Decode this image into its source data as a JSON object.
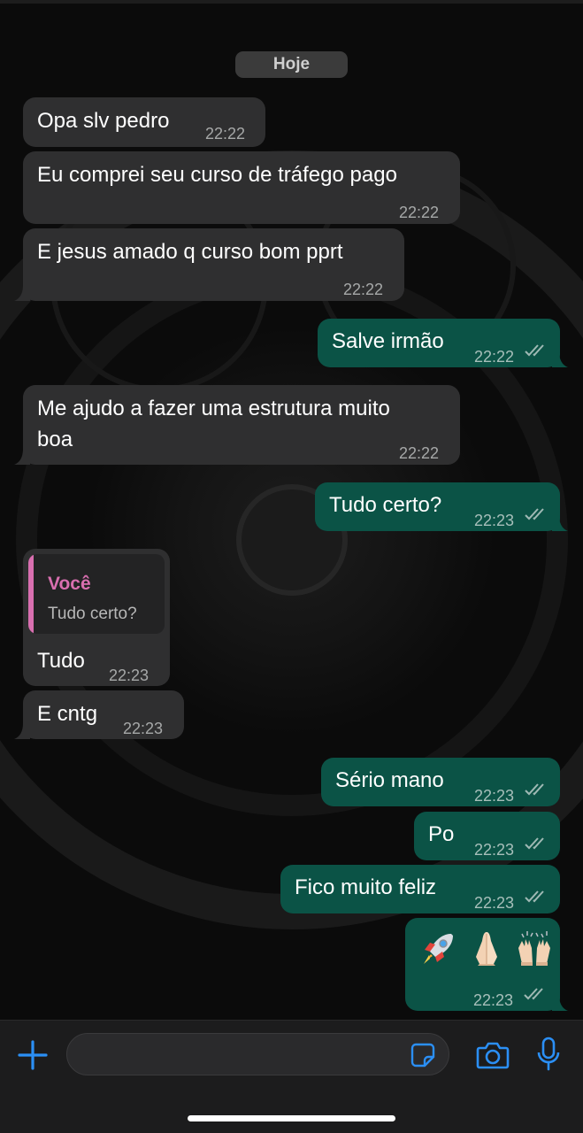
{
  "date_label": "Hoje",
  "messages": [
    {
      "dir": "in",
      "text": "Opa slv pedro",
      "time": "22:22"
    },
    {
      "dir": "in",
      "text": "Eu comprei seu curso de tráfego pago",
      "time": "22:22"
    },
    {
      "dir": "in",
      "text": "E jesus amado q curso bom pprt",
      "time": "22:22"
    },
    {
      "dir": "out",
      "text": "Salve irmão",
      "time": "22:22"
    },
    {
      "dir": "in",
      "line1": "Me ajudo a fazer uma estrutura muito",
      "line2": "boa",
      "time": "22:22"
    },
    {
      "dir": "out",
      "text": "Tudo certo?",
      "time": "22:23"
    },
    {
      "dir": "in",
      "quote_author": "Você",
      "quote_text": "Tudo certo?",
      "text": "Tudo",
      "time": "22:23"
    },
    {
      "dir": "in",
      "text": "E cntg",
      "time": "22:23"
    },
    {
      "dir": "out",
      "text": "Sério mano",
      "time": "22:23"
    },
    {
      "dir": "out",
      "text": "Po",
      "time": "22:23"
    },
    {
      "dir": "out",
      "text": "Fico muito feliz",
      "time": "22:23"
    },
    {
      "dir": "out",
      "emojis": [
        "rocket-emoji",
        "folded-hands-emoji",
        "raising-hands-emoji"
      ],
      "time": "22:23"
    }
  ],
  "input": {
    "value": "",
    "placeholder": ""
  },
  "icons": {
    "attach": "plus-icon",
    "sticker": "sticker-icon",
    "camera": "camera-icon",
    "mic": "microphone-icon"
  },
  "colors": {
    "incoming_bubble": "#2f2f30",
    "outgoing_bubble": "#0b5346",
    "accent": "#2b8ff5",
    "quote_author": "#d96fb0"
  }
}
